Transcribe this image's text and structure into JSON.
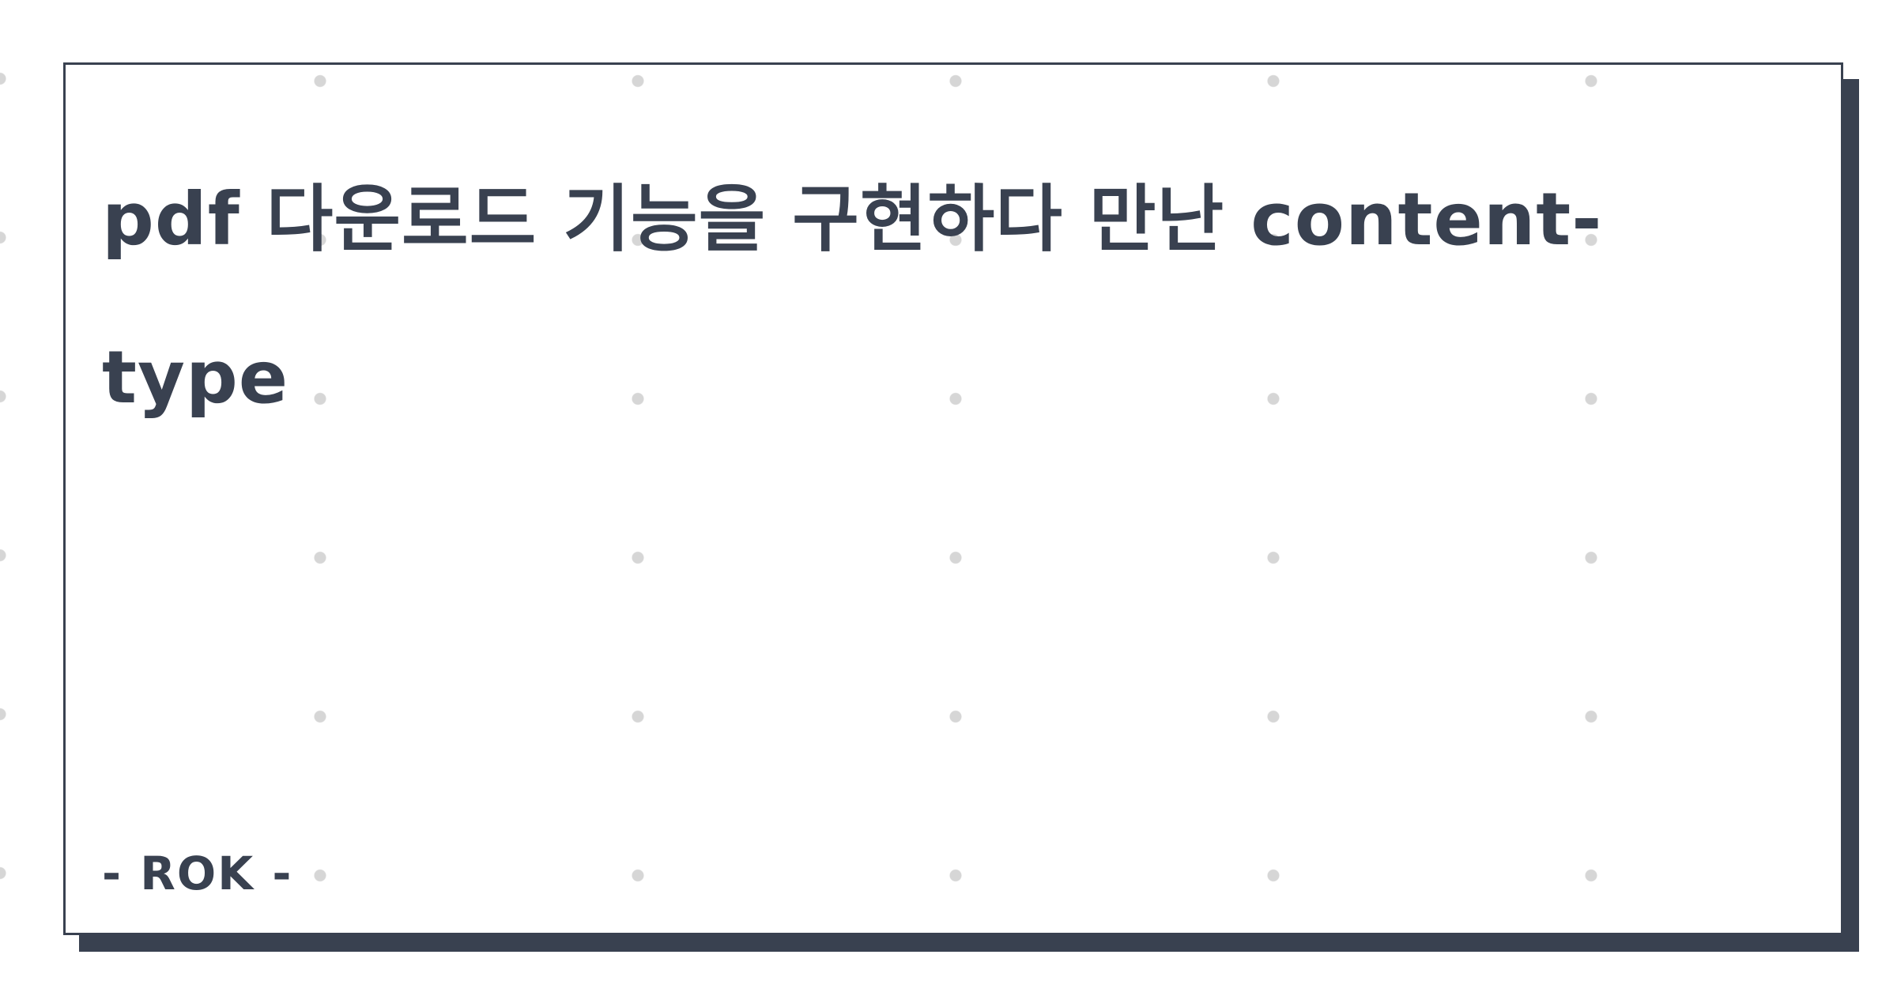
{
  "card": {
    "title": "pdf 다운로드 기능을 구현하다 만난 content-type",
    "author": "- ROK -"
  },
  "colors": {
    "text": "#394150",
    "shadow": "#394150",
    "border": "#394150",
    "background": "#ffffff",
    "dot": "#d6d6d6"
  }
}
